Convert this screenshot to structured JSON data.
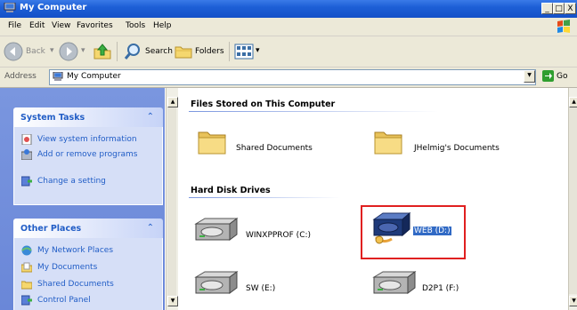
{
  "window": {
    "title": "My Computer",
    "controls": [
      "_",
      "□",
      "X"
    ]
  },
  "menu": [
    "File",
    "Edit",
    "View",
    "Favorites",
    "Tools",
    "Help"
  ],
  "toolbar": {
    "back": "Back",
    "search": "Search",
    "folders": "Folders"
  },
  "address": {
    "label": "Address",
    "value": "My Computer",
    "go": "Go"
  },
  "left_pane": {
    "system_tasks": {
      "title": "System Tasks",
      "items": [
        "View system information",
        "Add or remove programs",
        "Change a setting"
      ]
    },
    "other_places": {
      "title": "Other Places",
      "items": [
        "My Network Places",
        "My Documents",
        "Shared Documents",
        "Control Panel"
      ]
    }
  },
  "main": {
    "files_section": {
      "title": "Files Stored on This Computer",
      "items": [
        "Shared Documents",
        "JHelmig's Documents"
      ]
    },
    "drives_section": {
      "title": "Hard Disk Drives",
      "items": [
        "WINXPPROF (C:)",
        "WEB (D:)",
        "SW (E:)",
        "D2P1 (F:)"
      ]
    }
  },
  "colors": {
    "titlebar": "#1d5fd6",
    "panel_bg": "#d6dff7",
    "pane_bg": "#7a96df",
    "highlight_box": "#e02020",
    "selection": "#316ac5"
  }
}
